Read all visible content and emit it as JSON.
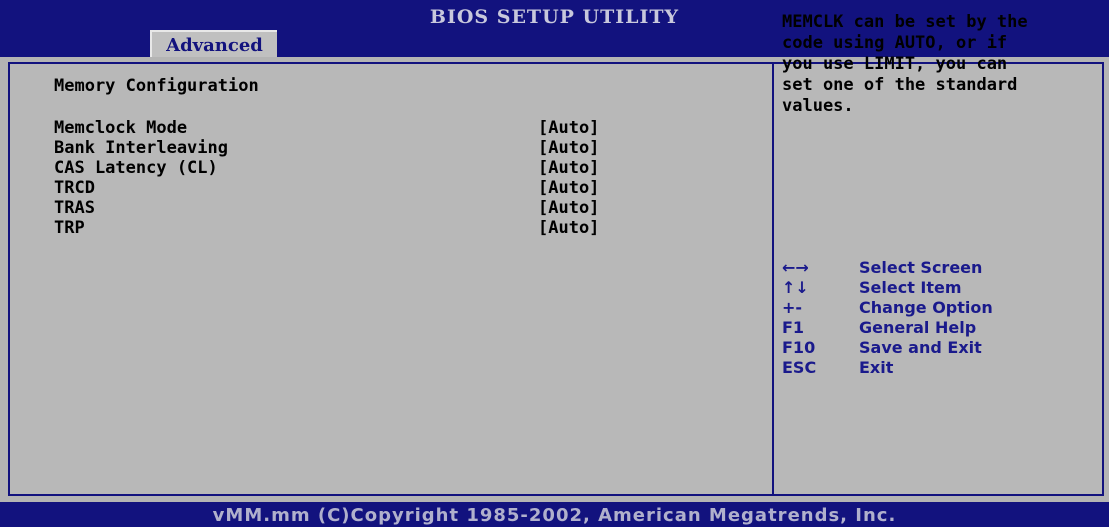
{
  "header": {
    "title": "BIOS SETUP UTILITY",
    "active_tab": "Advanced"
  },
  "main": {
    "section_title": "Memory Configuration",
    "items": [
      {
        "label": "Memclock Mode",
        "value": "[Auto]"
      },
      {
        "label": "Bank Interleaving",
        "value": "[Auto]"
      },
      {
        "label": "CAS Latency (CL)",
        "value": "[Auto]"
      },
      {
        "label": "TRCD",
        "value": "[Auto]"
      },
      {
        "label": "TRAS",
        "value": "[Auto]"
      },
      {
        "label": "TRP",
        "value": "[Auto]"
      }
    ]
  },
  "help": {
    "lines": [
      "MEMCLK can be set by the",
      "code using AUTO, or if",
      "you use LIMIT, you can",
      "set one of the standard",
      "values."
    ]
  },
  "keys": [
    {
      "key": "←→",
      "desc": "Select Screen"
    },
    {
      "key": "↑↓",
      "desc": "Select Item"
    },
    {
      "key": "+-",
      "desc": "Change Option"
    },
    {
      "key": "F1",
      "desc": "General Help"
    },
    {
      "key": "F10",
      "desc": "Save and Exit"
    },
    {
      "key": "ESC",
      "desc": "Exit"
    }
  ],
  "footer": {
    "copyright": "vMM.mm (C)Copyright 1985-2002, American Megatrends, Inc."
  },
  "colors": {
    "bar_blue": "#12127e",
    "panel_gray": "#b8b8b8",
    "key_text": "#1a1a8c"
  }
}
